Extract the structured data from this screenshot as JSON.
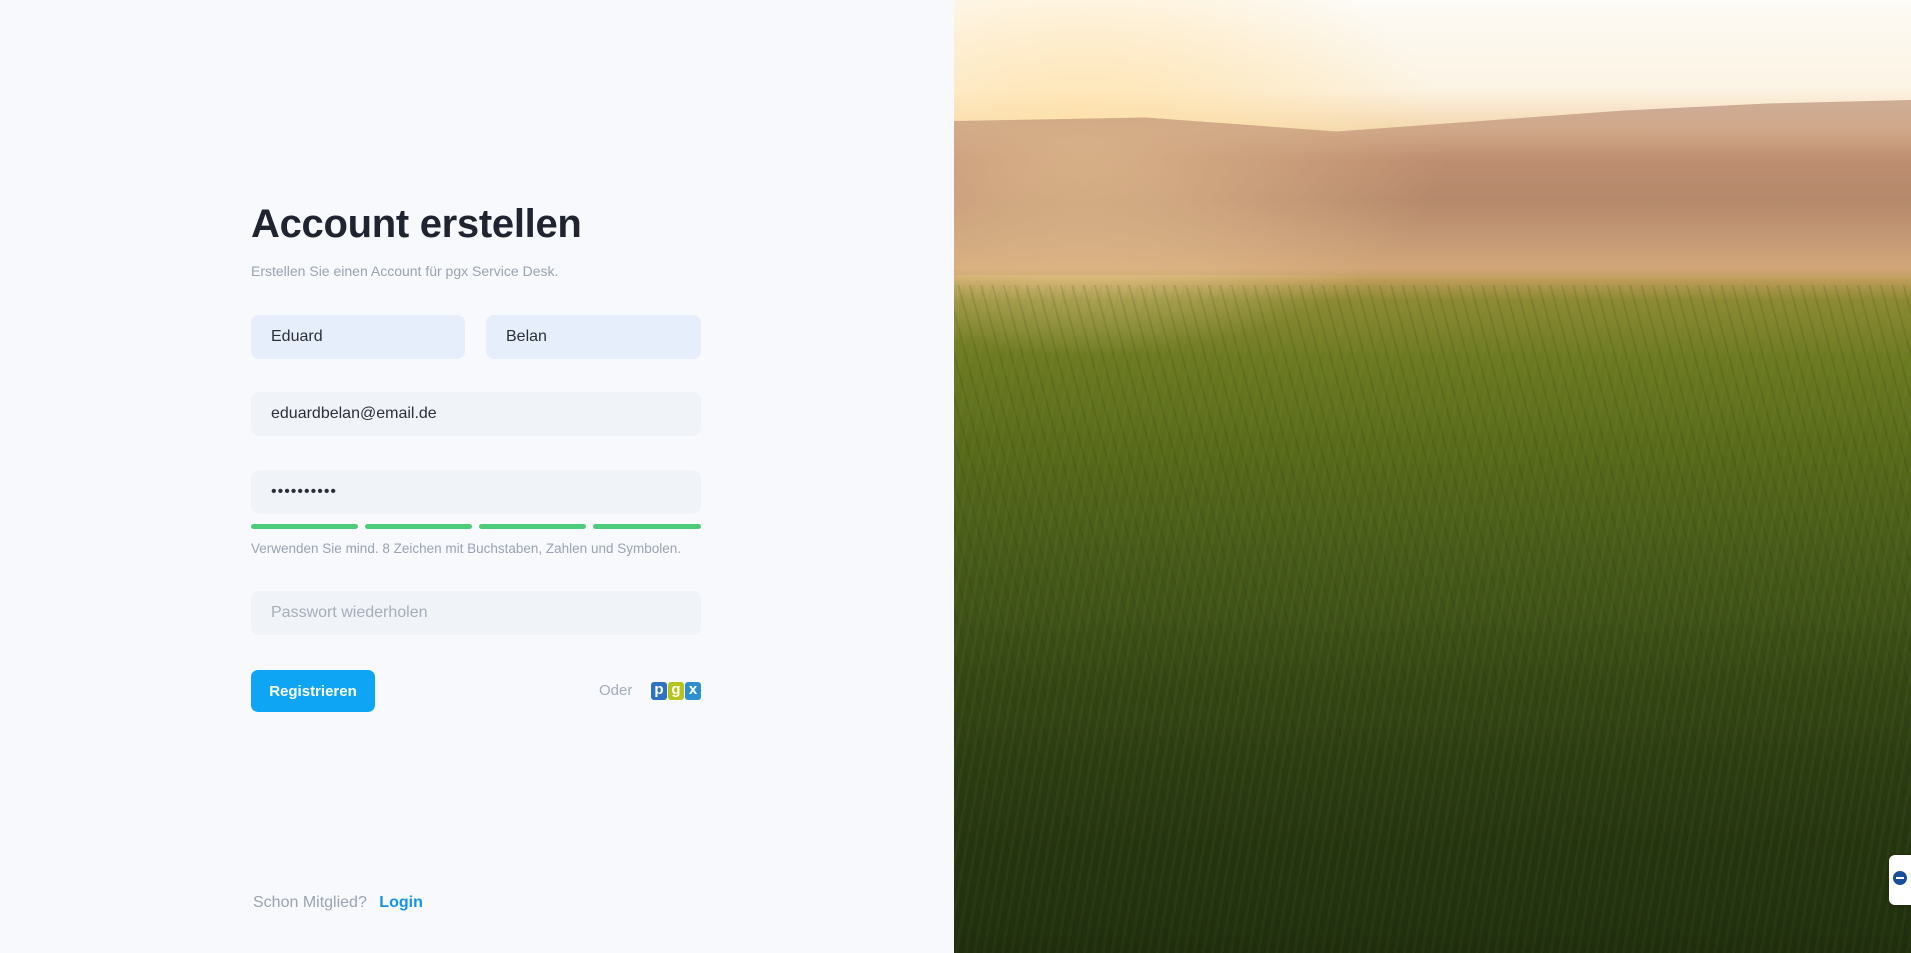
{
  "header": {
    "title": "Account erstellen",
    "subtitle": "Erstellen Sie einen Account für pgx Service Desk."
  },
  "form": {
    "first_name": {
      "value": "Eduard"
    },
    "last_name": {
      "value": "Belan"
    },
    "email": {
      "value": "eduardbelan@email.de"
    },
    "password": {
      "value": "••••••••••"
    },
    "password_strength": {
      "filled_segments": 4,
      "total_segments": 4,
      "color": "#4ccb79"
    },
    "password_hint": "Verwenden Sie mind. 8 Zeichen mit Buchstaben, Zahlen und Symbolen.",
    "password_repeat": {
      "placeholder": "Passwort wiederholen"
    },
    "submit_label": "Registrieren",
    "or_label": "Oder"
  },
  "sso": {
    "logo_text": {
      "p": "p",
      "g": "g",
      "x": "x"
    },
    "icon": "pgx-logo-icon"
  },
  "footer": {
    "question": "Schon Mitglied?",
    "login_label": "Login"
  },
  "colors": {
    "accent": "#0ea5f4",
    "link": "#1593e6",
    "strength": "#4ccb79"
  }
}
